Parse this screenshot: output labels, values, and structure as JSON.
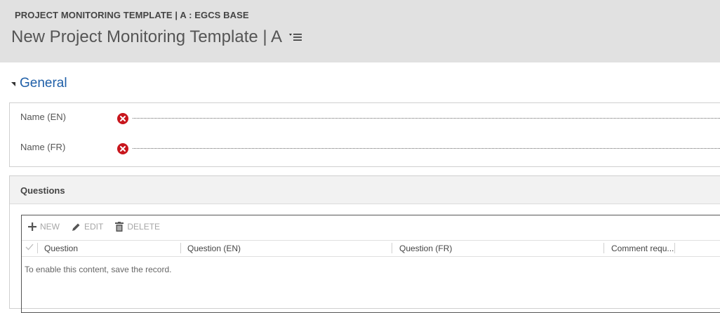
{
  "header": {
    "breadcrumb": "PROJECT MONITORING TEMPLATE | A : EGCS BASE",
    "title": "New Project Monitoring Template | A",
    "menu_icon": "list-menu-icon"
  },
  "general": {
    "section_title": "General",
    "fields": [
      {
        "label": "Name (EN)",
        "value": "",
        "required_icon": "required-error-icon"
      },
      {
        "label": "Name (FR)",
        "value": "",
        "required_icon": "required-error-icon"
      }
    ]
  },
  "questions": {
    "title": "Questions",
    "toolbar": {
      "new_label": "NEW",
      "edit_label": "EDIT",
      "delete_label": "DELETE"
    },
    "columns": [
      "Question",
      "Question (EN)",
      "Question (FR)",
      "Comment requ..."
    ],
    "empty_message": "To enable this content, save the record."
  },
  "colors": {
    "header_bg": "#e1e1e1",
    "section_title": "#1f5fa8",
    "error_red": "#c8161d",
    "disabled_text": "#a6a6a6"
  }
}
